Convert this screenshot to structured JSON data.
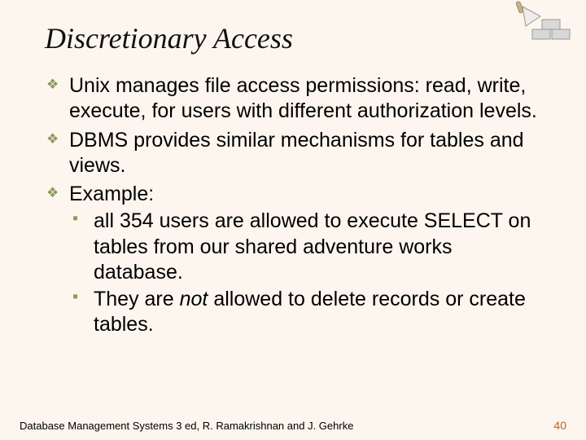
{
  "slide": {
    "title": "Discretionary Access",
    "bullets": [
      {
        "text": "Unix manages file access permissions: read, write, execute, for users with different authorization levels."
      },
      {
        "text": "DBMS provides similar mechanisms for tables and views."
      },
      {
        "text": "Example:",
        "sub": [
          {
            "text": "all 354 users are allowed to execute SELECT on tables from our shared adventure works database."
          },
          {
            "pre": "They are ",
            "em": "not",
            "post": " allowed to delete records or create tables."
          }
        ]
      }
    ],
    "footer_left": "Database Management Systems 3 ed, R. Ramakrishnan and J. Gehrke",
    "page_number": "40"
  }
}
